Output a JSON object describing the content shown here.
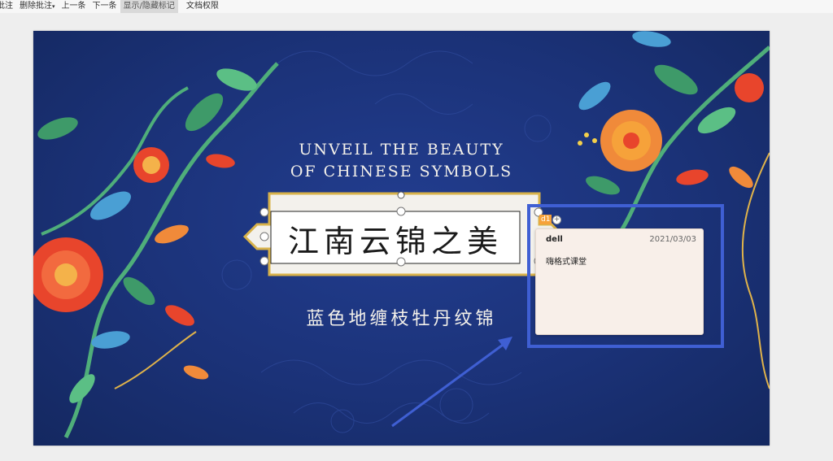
{
  "toolbar": {
    "items": [
      "批注",
      "删除批注",
      "上一条",
      "下一条",
      "显示/隐藏标记",
      "文档权限"
    ]
  },
  "slide": {
    "title_en_line1": "UNVEIL THE BEAUTY",
    "title_en_line2": "OF CHINESE SYMBOLS",
    "banner_title": "江南云锦之美",
    "subtitle": "蓝色地缠枝牡丹纹锦"
  },
  "comment": {
    "tag": "d1",
    "add_symbol": "+",
    "author": "dell",
    "date": "2021/03/03",
    "body": "嗨格式课堂"
  },
  "colors": {
    "slide_bg": "#1b3278",
    "highlight": "#3f5fd3",
    "comment_bg": "#f8efe9",
    "tag_bg": "#f6a23a"
  }
}
